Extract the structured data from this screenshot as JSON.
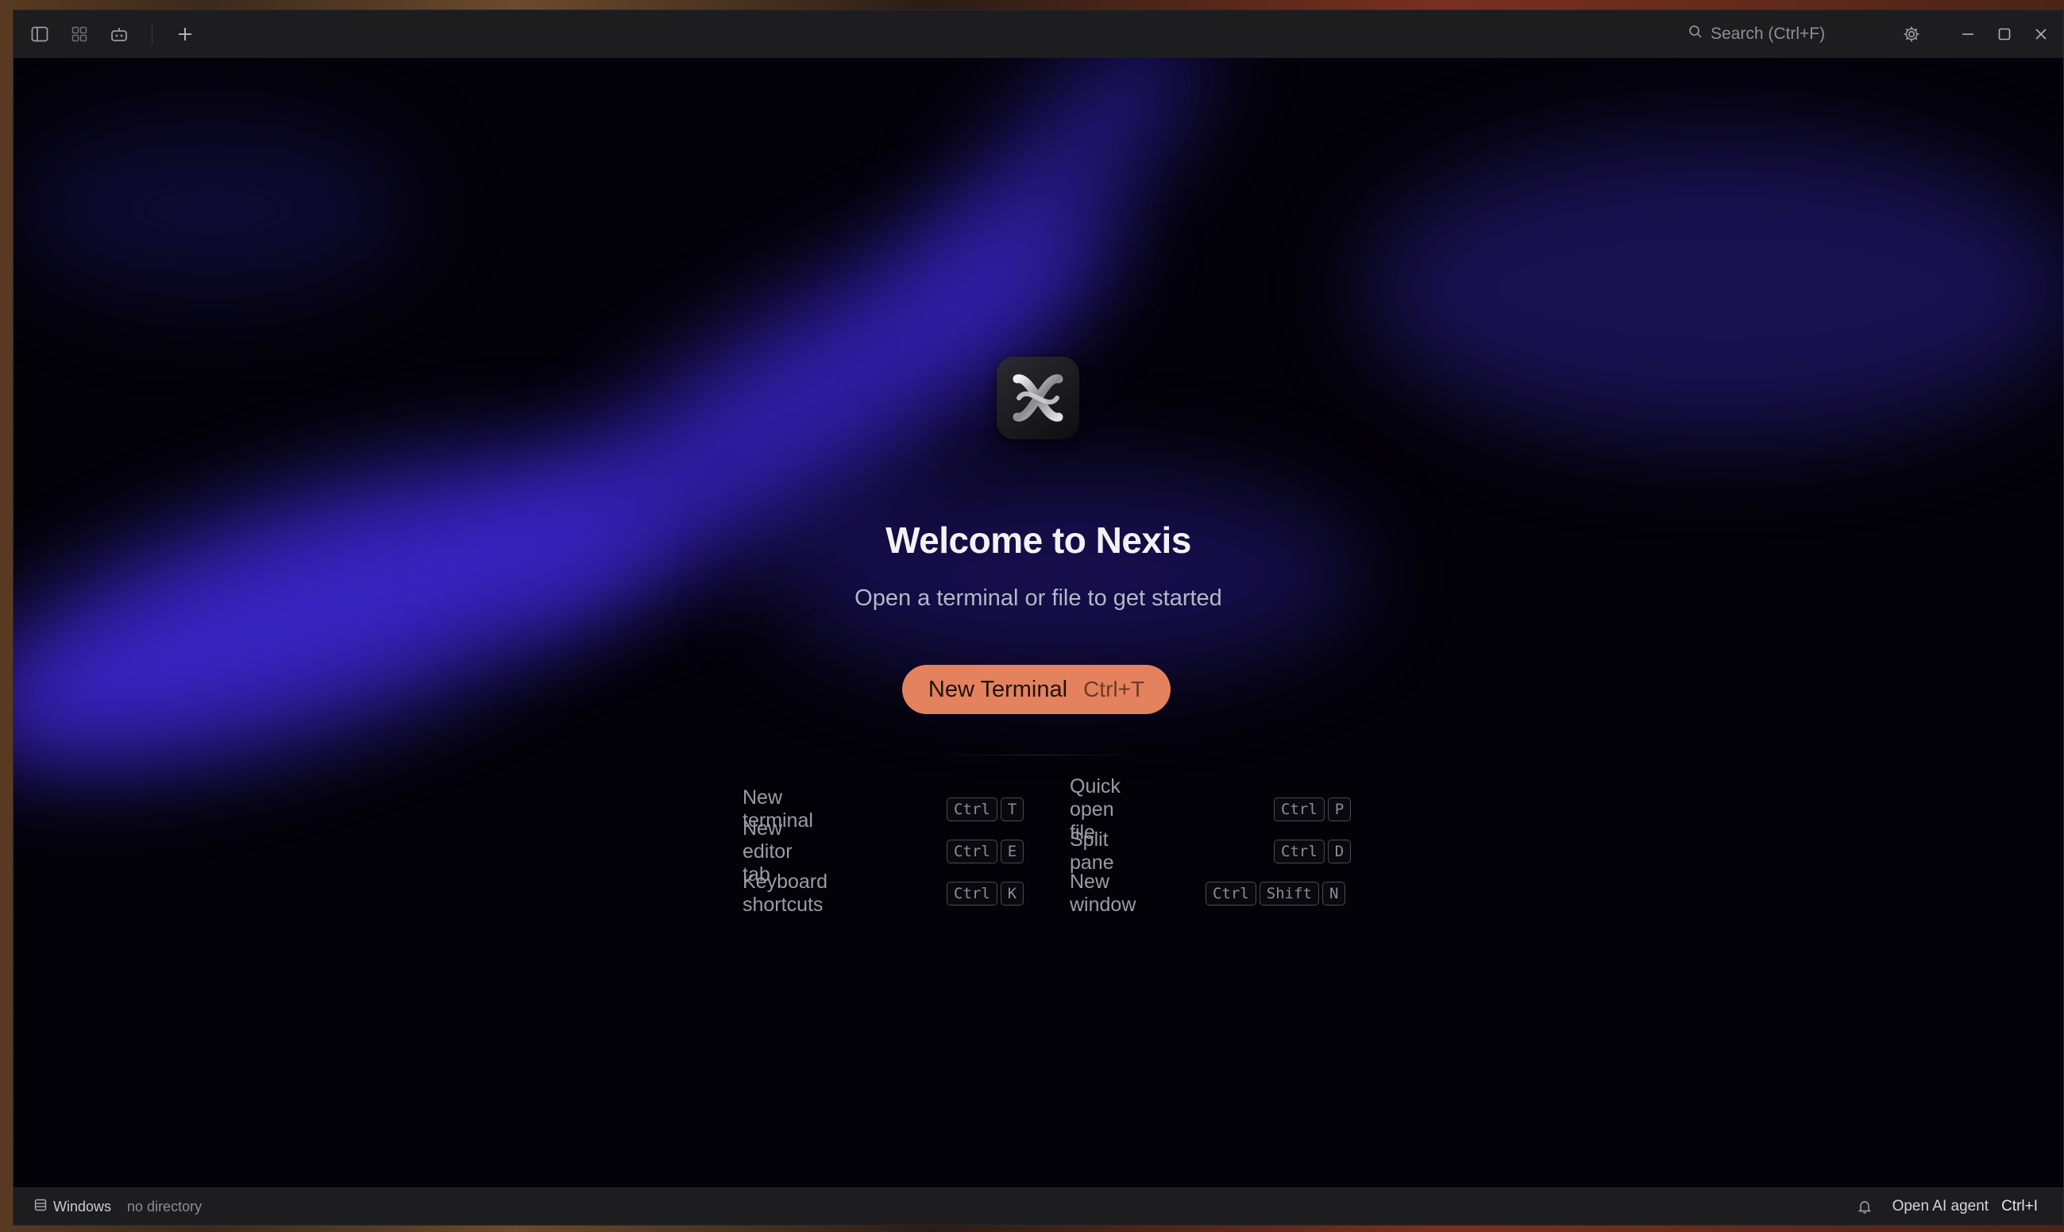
{
  "titlebar": {
    "search_placeholder": "Search (Ctrl+F)",
    "icons": [
      "sidebar-toggle-icon",
      "grid-icon",
      "robot-icon",
      "plus-icon",
      "search-icon",
      "gear-icon",
      "minimize-icon",
      "maximize-icon",
      "close-icon"
    ]
  },
  "welcome": {
    "title": "Welcome to Nexis",
    "subtitle": "Open a terminal or file to get started",
    "cta_label": "New Terminal",
    "cta_shortcut": "Ctrl+T"
  },
  "shortcuts": {
    "left": [
      {
        "label": "New terminal",
        "keys": [
          "Ctrl",
          "T"
        ]
      },
      {
        "label": "New editor tab",
        "keys": [
          "Ctrl",
          "E"
        ]
      },
      {
        "label": "Keyboard shortcuts",
        "keys": [
          "Ctrl",
          "K"
        ]
      }
    ],
    "right": [
      {
        "label": "Quick open file",
        "keys": [
          "Ctrl",
          "P"
        ]
      },
      {
        "label": "Split pane",
        "keys": [
          "Ctrl",
          "D"
        ]
      },
      {
        "label": "New window",
        "keys": [
          "Ctrl",
          "Shift",
          "N"
        ]
      }
    ]
  },
  "statusbar": {
    "windows_label": "Windows",
    "directory": "no directory",
    "agent_label": "Open AI agent",
    "agent_shortcut": "Ctrl+I"
  },
  "colors": {
    "accent": "#e4825e",
    "glow": "#3b25c9",
    "background": "#030208",
    "chrome": "#1d1d20"
  }
}
